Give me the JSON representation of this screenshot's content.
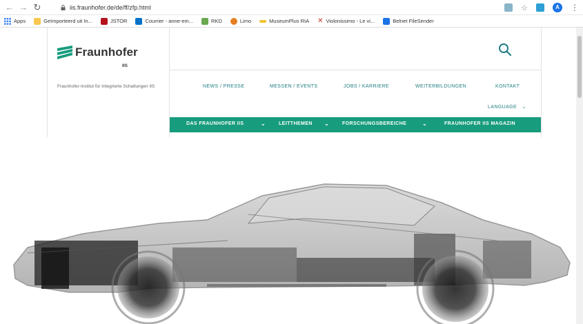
{
  "browser": {
    "url": "iis.fraunhofer.de/de/ff/zfp.html",
    "back_icon": "back-arrow-icon",
    "forward_icon": "forward-arrow-icon",
    "reload_icon": "reload-icon",
    "profile_initial": "A"
  },
  "bookmarks": [
    {
      "label": "Apps",
      "color": "#4285f4"
    },
    {
      "label": "Geïmporteerd uit In...",
      "color": "#f9c74f"
    },
    {
      "label": "JSTOR",
      "color": "#b5121b"
    },
    {
      "label": "Courrier - anne-em...",
      "color": "#0072c6"
    },
    {
      "label": "RKD",
      "color": "#6aa84f"
    },
    {
      "label": "Limo",
      "color": "#e67e22"
    },
    {
      "label": "MuseumPlus RIA",
      "color": "#f1c232"
    },
    {
      "label": "Violonissimo - Le vi...",
      "color": "#c0392b"
    },
    {
      "label": "Belnet FileSender",
      "color": "#1a73e8"
    }
  ],
  "site": {
    "logo_text": "Fraunhofer",
    "logo_sub": "IIS",
    "institute": "Fraunhofer-Institut für Integrierte Schaltungen IIS",
    "service_nav": [
      "NEWS / PRESSE",
      "MESSEN / EVENTS",
      "JOBS / KARRIERE",
      "WEITERBILDUNGEN",
      "KONTAKT"
    ],
    "language": "LANGUAGE",
    "main_nav": [
      "DAS FRAUNHOFER IIS",
      "LEITTHEMEN",
      "FORSCHUNGSBEREICHE",
      "FRAUNHOFER IIS MAGAZIN"
    ],
    "accent": "#179c7d"
  }
}
